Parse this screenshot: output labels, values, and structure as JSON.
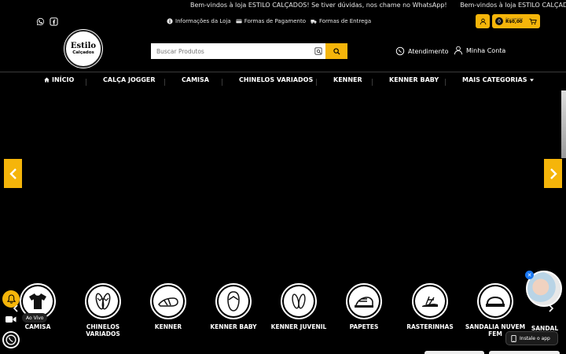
{
  "announcement": {
    "messages": [
      "Bem-vindos à loja ESTILO CALÇADOS! Se tiver dúvidas, nos chame no WhatsApp!",
      "Bem-vindos à loja ESTILO CALÇADOS! Se tiver dúvidas, nos chame no WhatsApp!"
    ]
  },
  "social": {
    "icons": [
      "whatsapp-icon",
      "facebook-icon"
    ]
  },
  "info_links": [
    {
      "label": "Informações da Loja",
      "icon": "info-icon"
    },
    {
      "label": "Formas de Pagamento",
      "icon": "credit-card-icon"
    },
    {
      "label": "Formas de Entrega",
      "icon": "truck-icon"
    }
  ],
  "cart": {
    "count": "0",
    "label": "Seu carrinho",
    "value": "R$0,00"
  },
  "logo": {
    "line1": "Estilo",
    "line2": "Calçados"
  },
  "search": {
    "placeholder": "Buscar Produtos"
  },
  "header_actions": {
    "atendimento": "Atendimento",
    "minha_conta": "Minha Conta"
  },
  "nav": {
    "items": [
      "INÍCIO",
      "CALÇA JOGGER",
      "CAMISA",
      "CHINELOS VARIADOS",
      "KENNER",
      "KENNER BABY",
      "MAIS CATEGORIAS"
    ]
  },
  "categories": [
    {
      "label": "CAMISA",
      "icon": "tshirt-icon"
    },
    {
      "label": "CHINELOS VARIADOS",
      "icon": "flipflops-icon"
    },
    {
      "label": "KENNER",
      "icon": "sandal-icon"
    },
    {
      "label": "KENNER BABY",
      "icon": "flipflop-icon"
    },
    {
      "label": "KENNER JUVENIL",
      "icon": "flipflops-small-icon"
    },
    {
      "label": "PAPETES",
      "icon": "papete-icon"
    },
    {
      "label": "RASTERINHAS",
      "icon": "rasteirinha-icon"
    },
    {
      "label": "SANDALIA NUVEM FEM",
      "icon": "slide-icon"
    },
    {
      "label": "SANDAL",
      "icon": "sandal-icon"
    }
  ],
  "widgets": {
    "ao_vivo": "Ao Vivo",
    "install_app": "Instale o app"
  },
  "colors": {
    "accent": "#f5b50a",
    "background": "#000000"
  }
}
